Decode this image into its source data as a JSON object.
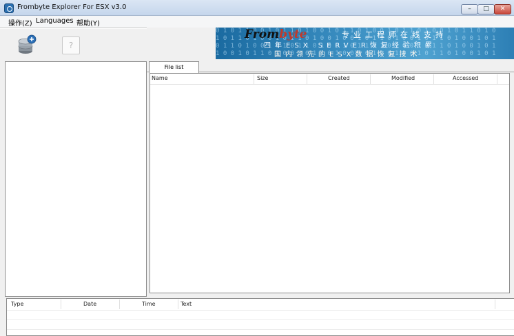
{
  "window": {
    "title": "Frombyte Explorer For ESX v3.0",
    "minimize_glyph": "–",
    "maximize_glyph": "□",
    "close_glyph": "✕"
  },
  "menu": {
    "items": [
      "操作(Z)",
      "Languages",
      "帮助(Y)"
    ]
  },
  "toolbar": {
    "db_icon": "database-add-icon",
    "help_icon": "help-icon",
    "help_glyph": "?"
  },
  "banner": {
    "brand_prefix": "From",
    "brand_suffix": "byte",
    "line1": "专业工程师在线支持",
    "line2": "四年ESX SERVER恢复经验积累",
    "line3": "国内领先的ESX数据恢复技术",
    "colors": {
      "bg": "#3b8fc2",
      "brand_accent": "#c0392b"
    }
  },
  "tabs": {
    "file_list": "File list"
  },
  "file_table": {
    "columns": [
      "Name",
      "Size",
      "Created",
      "Modified",
      "Accessed"
    ]
  },
  "log_table": {
    "columns": [
      "Type",
      "Date",
      "Time",
      "Text"
    ]
  }
}
